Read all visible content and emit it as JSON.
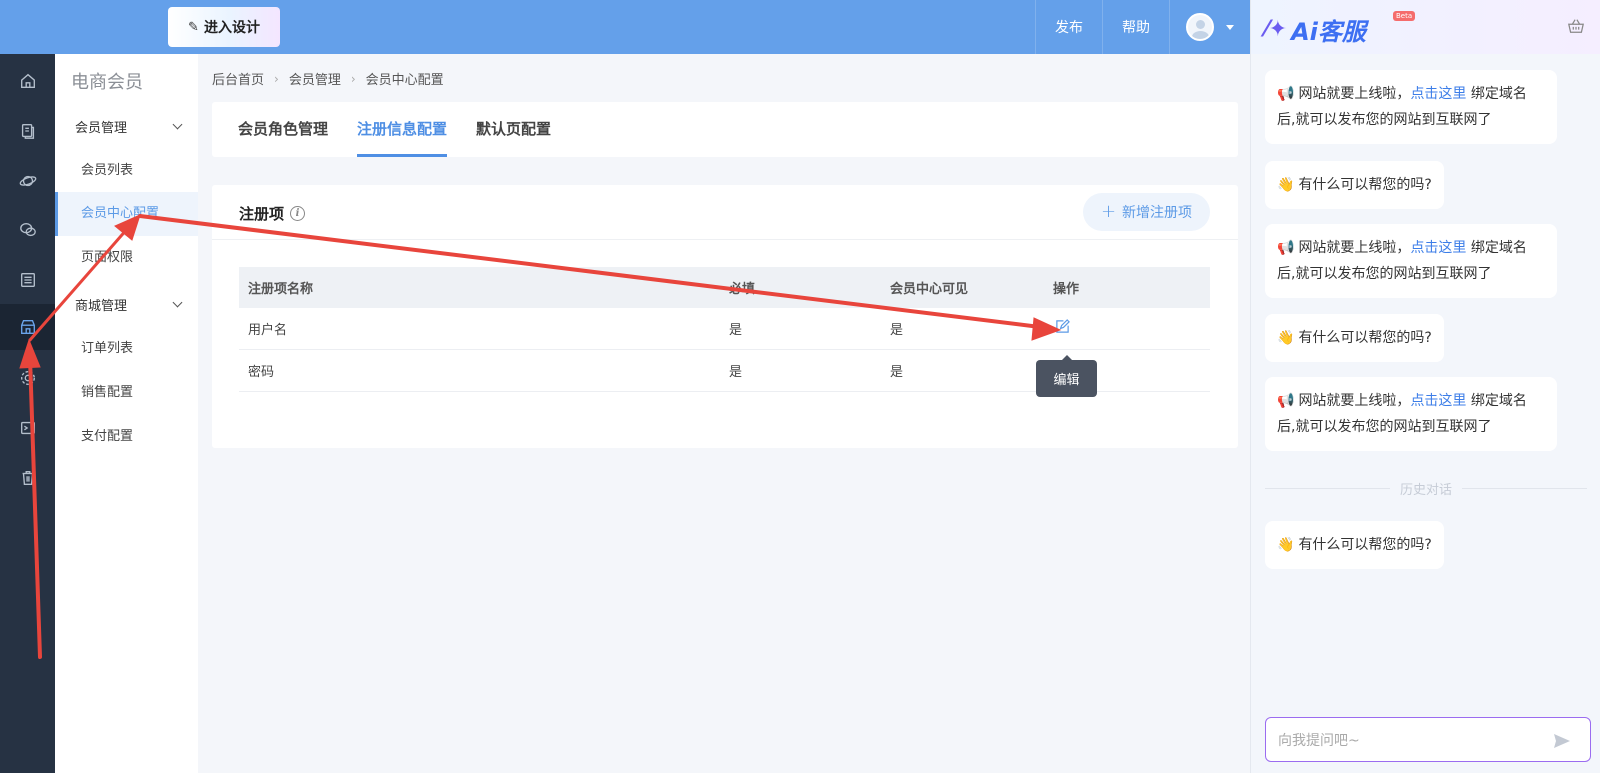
{
  "header": {
    "design_button": "进入设计",
    "publish": "发布",
    "help": "帮助"
  },
  "rail": {
    "icons": [
      "home-icon",
      "pages-icon",
      "planet-icon",
      "wechat-icon",
      "list-icon",
      "shop-icon",
      "gear-icon",
      "terminal-icon",
      "trash-icon"
    ],
    "active": "shop-icon"
  },
  "sidebar": {
    "title": "电商会员",
    "group1": "会员管理",
    "group1_items": [
      "会员列表",
      "会员中心配置",
      "页面权限"
    ],
    "group2": "商城管理",
    "group2_items": [
      "订单列表",
      "销售配置",
      "支付配置"
    ],
    "active_item": "会员中心配置"
  },
  "breadcrumb": [
    "后台首页",
    "会员管理",
    "会员中心配置"
  ],
  "tabs": [
    "会员角色管理",
    "注册信息配置",
    "默认页配置"
  ],
  "active_tab": "注册信息配置",
  "card": {
    "title": "注册项",
    "add_button": "新增注册项"
  },
  "table": {
    "headers": [
      "注册项名称",
      "必填",
      "会员中心可见",
      "操作"
    ],
    "rows": [
      {
        "name": "用户名",
        "required": "是",
        "visible": "是"
      },
      {
        "name": "密码",
        "required": "是",
        "visible": "是"
      }
    ]
  },
  "tooltip": "编辑",
  "ai": {
    "title": "Ai客服",
    "badge": "Beta",
    "msg_online_a": "网站就要上线啦，",
    "msg_online_link": "点击这里",
    "msg_online_b": "绑定域名后,就可以发布您的网站到互联网了",
    "msg_help": "有什么可以帮您的吗?",
    "history_divider": "历史对话",
    "input_placeholder": "向我提问吧~"
  },
  "colors": {
    "header_blue": "#64a0ea",
    "accent": "#4f8fe4",
    "rail_bg": "#263243",
    "annotation_red": "#e8453c"
  }
}
